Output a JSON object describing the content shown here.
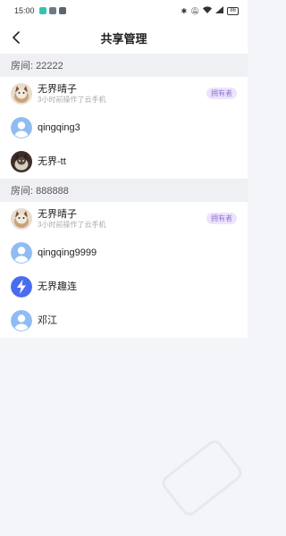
{
  "status_bar": {
    "time": "15:00",
    "battery": "86"
  },
  "header": {
    "title": "共享管理"
  },
  "rooms": [
    {
      "label": "房间: 22222",
      "members": [
        {
          "name": "无界晴子",
          "sub": "3小时前操作了云手机",
          "badge": "拥有者",
          "avatar": "photo-cat"
        },
        {
          "name": "qingqing3",
          "sub": "",
          "badge": "",
          "avatar": "default-user"
        },
        {
          "name": "无界-tt",
          "sub": "",
          "badge": "",
          "avatar": "photo-cat-dark"
        }
      ]
    },
    {
      "label": "房间: 888888",
      "members": [
        {
          "name": "无界晴子",
          "sub": "3小时前操作了云手机",
          "badge": "拥有者",
          "avatar": "photo-cat"
        },
        {
          "name": "qingqing9999",
          "sub": "",
          "badge": "",
          "avatar": "default-user"
        },
        {
          "name": "无界趣连",
          "sub": "",
          "badge": "",
          "avatar": "lightning-logo"
        },
        {
          "name": "邓江",
          "sub": "",
          "badge": "",
          "avatar": "default-user"
        }
      ]
    }
  ],
  "colors": {
    "badge_bg": "#ece4fb",
    "badge_text": "#9572d6",
    "default_avatar": "#8fbcf3",
    "logo_blue": "#4a6cf0"
  }
}
